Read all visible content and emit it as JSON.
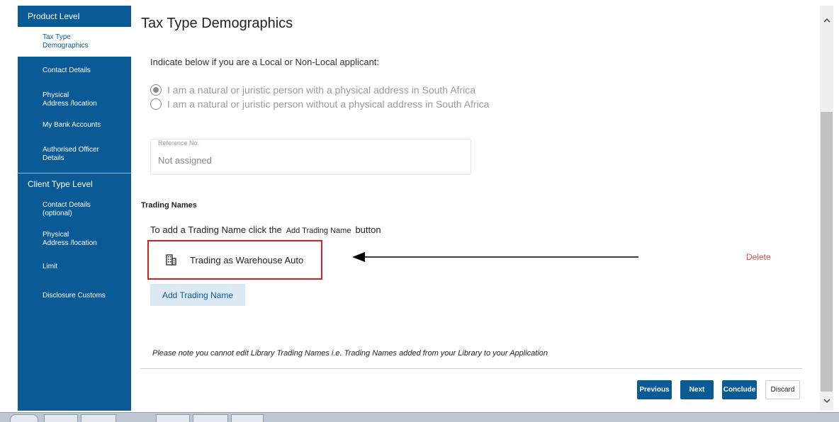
{
  "sidebar": {
    "product_level": "Product Level",
    "product_items": [
      {
        "line1": "Tax Type",
        "line2": "Demographics"
      },
      {
        "line1": "Contact Details",
        "line2": ""
      },
      {
        "line1": "Physical",
        "line2": "Address /location"
      },
      {
        "line1": "My Bank Accounts",
        "line2": ""
      },
      {
        "line1": "Authorised Officer",
        "line2": "Details"
      }
    ],
    "client_level": "Client Type Level",
    "client_items": [
      {
        "line1": "Contact Details",
        "line2": "(optional)"
      },
      {
        "line1": "Physical",
        "line2": "Address /location"
      },
      {
        "line1": "Limit",
        "line2": ""
      },
      {
        "line1": "Disclosure Customs",
        "line2": ""
      }
    ]
  },
  "main": {
    "title": "Tax Type Demographics",
    "local_prompt": "Indicate below if you are a Local or Non-Local applicant:",
    "radios": [
      {
        "label": "I am a natural or juristic person with a physical address in South Africa",
        "checked": true
      },
      {
        "label": "I am a natural or juristic person without a physical address in South Africa",
        "checked": false
      }
    ],
    "reference": {
      "label": "Reference No.",
      "value": "Not assigned"
    },
    "trading": {
      "heading": "Trading Names",
      "instr_before": "To add a Trading Name click the",
      "instr_button": "Add Trading Name",
      "instr_after": "button",
      "entry": "Trading as Warehouse Auto",
      "delete": "Delete",
      "add_button": "Add Trading Name"
    },
    "note": "Please note  you cannot edit Library Trading Names i.e. Trading Names added from your Library to your Application",
    "buttons": {
      "previous": "Previous",
      "next": "Next",
      "conclude": "Conclude",
      "discard": "Discard"
    }
  },
  "colors": {
    "sidebar": "#0a5a96",
    "highlight": "#d82020",
    "delete": "#d9534f"
  },
  "icons": {
    "trading_entry": "building-icon",
    "scroll_up": "chevron-up-icon",
    "scroll_down": "chevron-down-icon"
  }
}
